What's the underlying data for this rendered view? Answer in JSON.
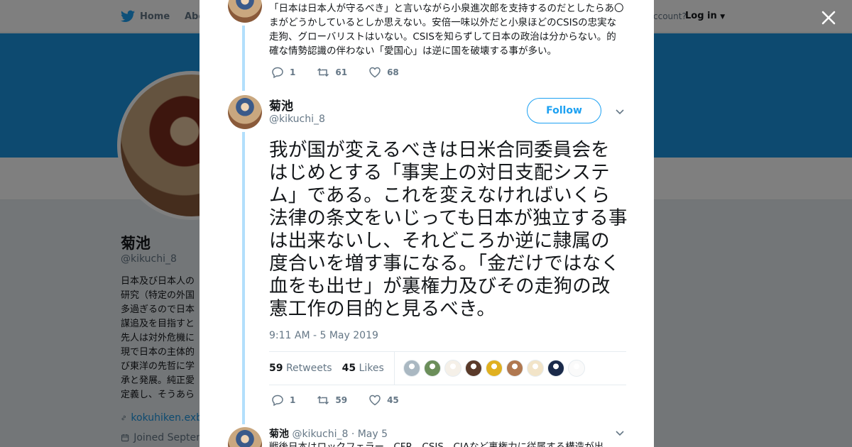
{
  "nav": {
    "home": "Home",
    "about": "Abo",
    "account_prompt": "ccount?",
    "login": "Log in"
  },
  "profile": {
    "name": "菊池",
    "handle": "@kikuchi_8",
    "bio_lines": [
      "日本及び日本人の",
      "研究（特定の外国",
      "多過ぎるので日本",
      "謀追及を目指すと",
      "先人は対外危機に",
      "現で日本の主体的",
      "び東洋の先哲に学",
      "承と発展。純正愛",
      "定義し、そうあら"
    ],
    "link": "kokuhiken.exb",
    "joined": "Joined Septen"
  },
  "prev_tweet": {
    "text": "「日本は日本人が守るべき」と言いながら小泉進次郎を支持するのだとしたらあ〇まがどうかしているとしか思えない。安倍一味以外だと小泉ほどのCSISの忠実な走狗、グローバリストはいない。CSISを知らずして日本の政治は分からない。的確な情勢認識の伴わない「愛国心」は逆に国を破壊する事が多い。",
    "replies": "1",
    "retweets": "61",
    "likes": "68"
  },
  "main_tweet": {
    "name": "菊池",
    "handle": "@kikuchi_8",
    "follow_label": "Follow",
    "text": "我が国が変えるべきは日米合同委員会をはじめとする「事実上の対日支配システム」である。これを変えなければいくら法律の条文をいじっても日本が独立する事は出来ないし、それどころか逆に隷属の度合いを増す事になる。「金だけではなく血をも出せ」が裏権力及びその走狗の改憲工作の目的と見るべき。",
    "timestamp": "9:11 AM - 5 May 2019",
    "retweet_count": "59",
    "retweet_label": "Retweets",
    "like_count": "45",
    "like_label": "Likes",
    "replies": "1",
    "retweets": "59",
    "likes": "45"
  },
  "likers": [
    {
      "name": "liker-avatar-1",
      "color": "#aab8c2"
    },
    {
      "name": "liker-avatar-2",
      "color": "#6b8e5a"
    },
    {
      "name": "liker-avatar-3",
      "color": "#f5f0e8"
    },
    {
      "name": "liker-avatar-4",
      "color": "#5a3a2a"
    },
    {
      "name": "liker-avatar-5",
      "color": "#e0b020"
    },
    {
      "name": "liker-avatar-6",
      "color": "#b07850"
    },
    {
      "name": "liker-avatar-7",
      "color": "#f2e4c8"
    },
    {
      "name": "liker-avatar-8",
      "color": "#1a2a4a"
    },
    {
      "name": "liker-avatar-9",
      "color": "#fafafa"
    }
  ],
  "reply_tweet": {
    "name": "菊池",
    "handle": "@kikuchi_8",
    "date": "· May 5",
    "text": "戦後日本はロックフェラー、CFR、CSIS、CIAなど裏権力に従属する構造が出"
  },
  "colors": {
    "brand": "#1da1f2",
    "banner": "#1b95e0",
    "thread": "#b2dffc"
  }
}
